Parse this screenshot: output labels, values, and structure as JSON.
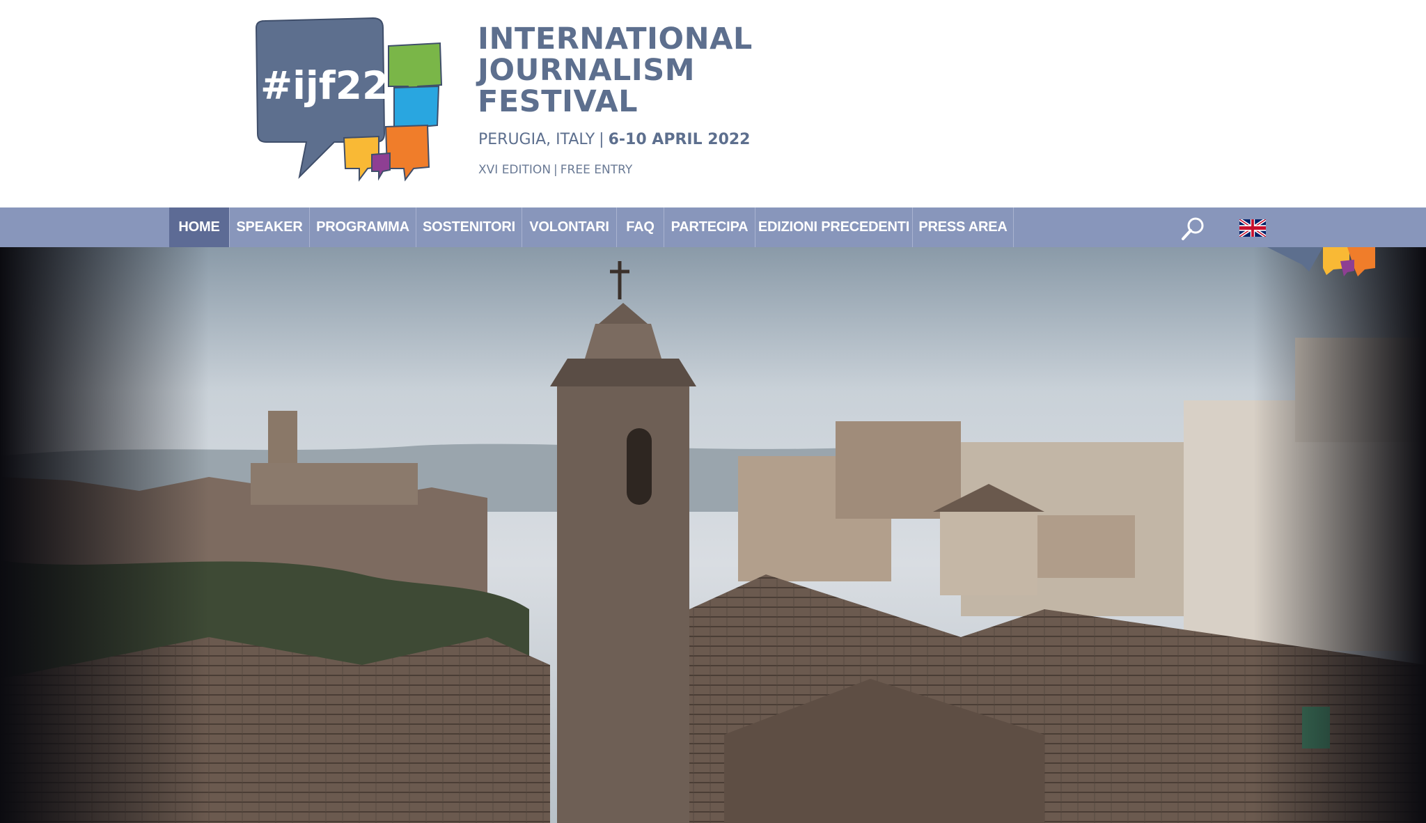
{
  "brand": {
    "logo_hashtag": "#ijf22",
    "title_lines": [
      "INTERNATIONAL",
      "JOURNALISM",
      "FESTIVAL"
    ],
    "location": "PERUGIA, ITALY",
    "dates": "6-10 APRIL 2022",
    "edition": "XVI EDITION",
    "entry": "FREE ENTRY",
    "colors": {
      "primary": "#5d6f8e",
      "bubble_green": "#7ab648",
      "bubble_blue": "#29a6e0",
      "bubble_orange": "#f07d2a",
      "bubble_yellow": "#f9b935",
      "bubble_purple": "#8e3f93"
    }
  },
  "nav": {
    "items": [
      {
        "label": "HOME",
        "active": true
      },
      {
        "label": "SPEAKER",
        "active": false
      },
      {
        "label": "PROGRAMMA",
        "active": false
      },
      {
        "label": "SOSTENITORI",
        "active": false
      },
      {
        "label": "VOLONTARI",
        "active": false
      },
      {
        "label": "FAQ",
        "active": false
      },
      {
        "label": "PARTECIPA",
        "active": false
      },
      {
        "label": "EDIZIONI PRECEDENTI",
        "active": false
      },
      {
        "label": "PRESS AREA",
        "active": false
      }
    ],
    "icons": {
      "search": "search-icon",
      "language": "uk-flag-icon"
    },
    "colors": {
      "bar": "#8896bb",
      "active": "#5d6b95",
      "text": "#ffffff"
    }
  },
  "hero": {
    "subject": "rooftop-panorama-image"
  }
}
